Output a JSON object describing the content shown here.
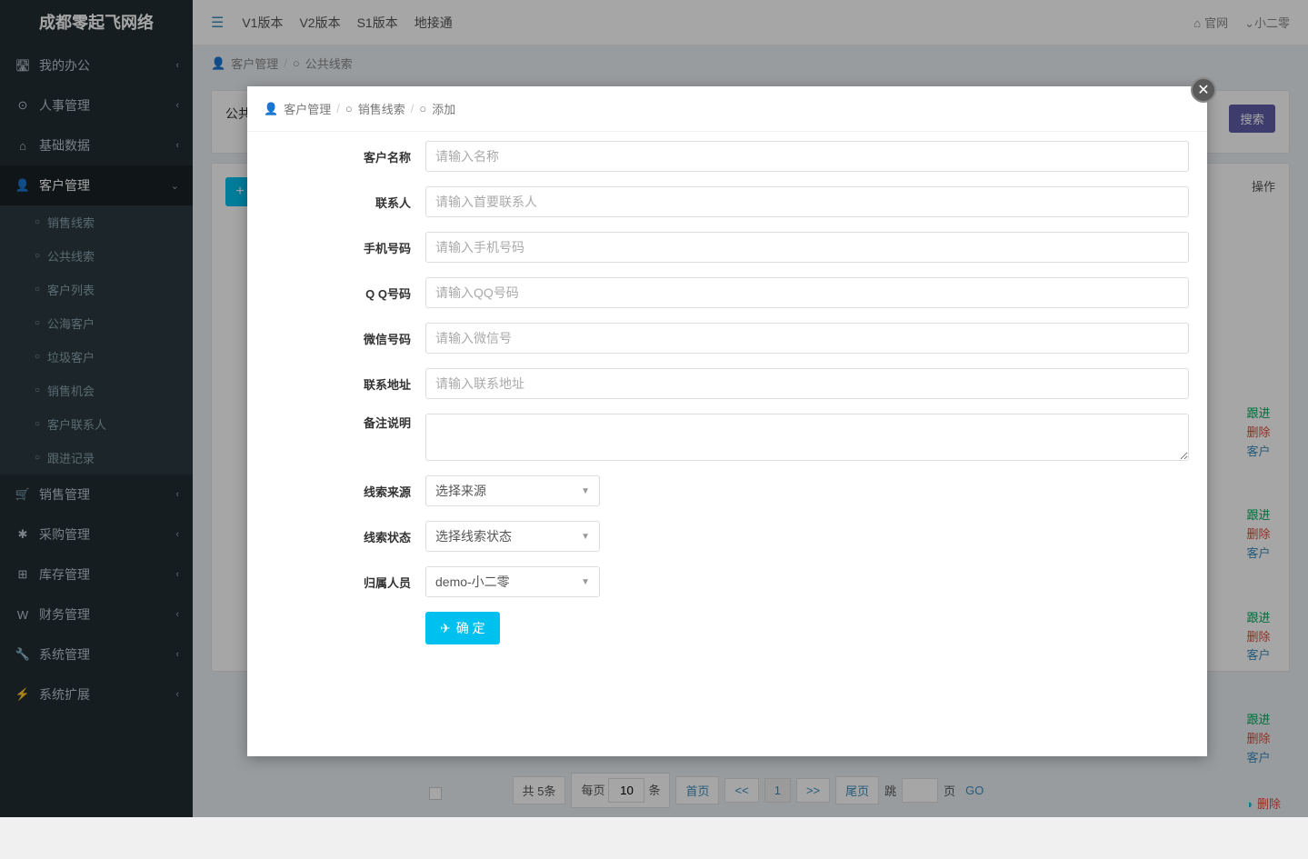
{
  "brand": "成都零起飞网络",
  "nav": {
    "links": [
      "V1版本",
      "V2版本",
      "S1版本",
      "地接通"
    ],
    "home": "官网",
    "user": "小二零"
  },
  "sidebar": {
    "items": [
      {
        "icon": "🛣",
        "label": "我的办公"
      },
      {
        "icon": "⊙",
        "label": "人事管理"
      },
      {
        "icon": "⌂",
        "label": "基础数据"
      },
      {
        "icon": "👤",
        "label": "客户管理",
        "active": true
      },
      {
        "icon": "🛒",
        "label": "销售管理"
      },
      {
        "icon": "✱",
        "label": "采购管理"
      },
      {
        "icon": "⊞",
        "label": "库存管理"
      },
      {
        "icon": "W",
        "label": "财务管理"
      },
      {
        "icon": "🔧",
        "label": "系统管理"
      },
      {
        "icon": "⚡",
        "label": "系统扩展"
      }
    ],
    "submenu": [
      "销售线索",
      "公共线索",
      "客户列表",
      "公海客户",
      "垃圾客户",
      "销售机会",
      "客户联系人",
      "跟进记录"
    ]
  },
  "breadcrumb": {
    "icon": "👤",
    "l1": "客户管理",
    "l2": "公共线索"
  },
  "page": {
    "title": "公共",
    "search_btn": "搜索",
    "op_header": "操作",
    "ops": {
      "follow": "跟进",
      "del": "删除",
      "cust": "客户"
    }
  },
  "pagination": {
    "total_prefix": "共",
    "total_suffix": "条",
    "total": "5",
    "per_page_prefix": "每页",
    "per_page": "10",
    "per_page_suffix": "条",
    "first": "首页",
    "prev": "<<",
    "current": "1",
    "next": ">>",
    "last": "尾页",
    "jump_prefix": "跳",
    "jump_suffix": "页",
    "go": "GO"
  },
  "modal": {
    "bc": {
      "l1": "客户管理",
      "l2": "销售线索",
      "l3": "添加"
    },
    "fields": {
      "customer_name": {
        "label": "客户名称",
        "placeholder": "请输入名称"
      },
      "contact": {
        "label": "联系人",
        "placeholder": "请输入首要联系人"
      },
      "phone": {
        "label": "手机号码",
        "placeholder": "请输入手机号码"
      },
      "qq": {
        "label": "Q Q号码",
        "placeholder": "请输入QQ号码"
      },
      "wechat": {
        "label": "微信号码",
        "placeholder": "请输入微信号"
      },
      "address": {
        "label": "联系地址",
        "placeholder": "请输入联系地址"
      },
      "remark": {
        "label": "备注说明"
      },
      "source": {
        "label": "线索来源",
        "value": "选择来源"
      },
      "status": {
        "label": "线索状态",
        "value": "选择线索状态"
      },
      "owner": {
        "label": "归属人员",
        "value": "demo-小二零"
      }
    },
    "submit": "确 定"
  }
}
